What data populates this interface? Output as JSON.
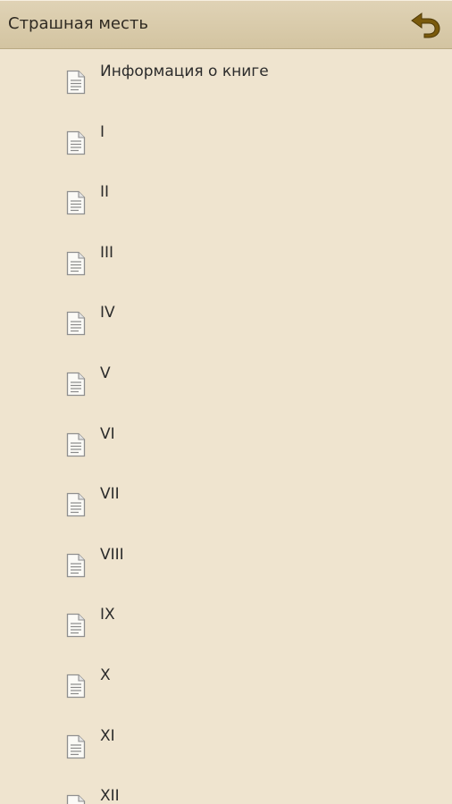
{
  "header": {
    "title": "Страшная месть",
    "back_icon": "back-arrow-icon",
    "back_color": "#7a5a0c"
  },
  "toc": {
    "item_icon": "document-icon",
    "items": [
      {
        "label": "Информация о книге"
      },
      {
        "label": "I"
      },
      {
        "label": "II"
      },
      {
        "label": "III"
      },
      {
        "label": "IV"
      },
      {
        "label": "V"
      },
      {
        "label": "VI"
      },
      {
        "label": "VII"
      },
      {
        "label": "VIII"
      },
      {
        "label": "IX"
      },
      {
        "label": "X"
      },
      {
        "label": "XI"
      },
      {
        "label": "XII"
      }
    ]
  },
  "colors": {
    "background": "#efe4cf",
    "header_background": "#d8caa9"
  }
}
